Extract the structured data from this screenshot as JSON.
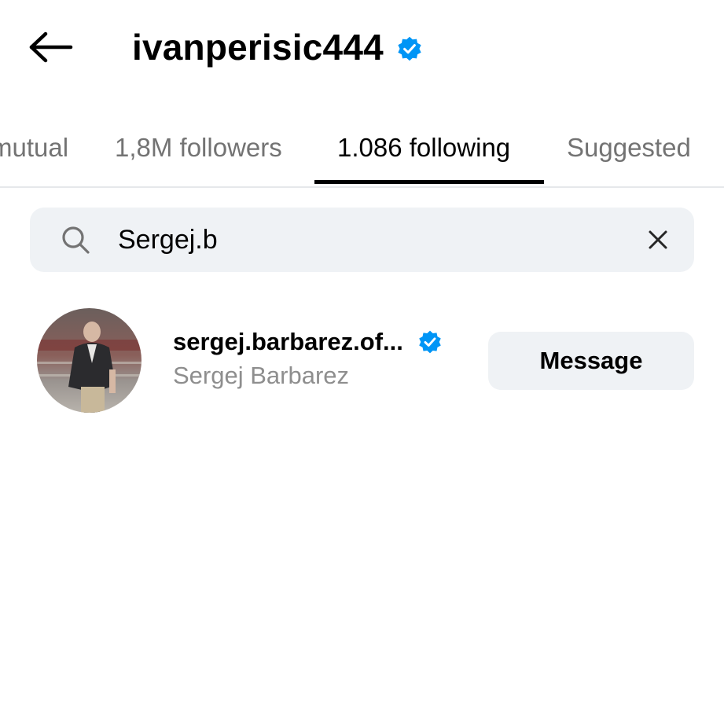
{
  "header": {
    "title": "ivanperisic444",
    "back_icon": "arrow-left-icon",
    "verified_icon": "verified-badge-icon"
  },
  "tabs": [
    {
      "label": "mutual",
      "active": false
    },
    {
      "label": "1,8M followers",
      "active": false
    },
    {
      "label": "1.086 following",
      "active": true
    },
    {
      "label": "Suggested",
      "active": false
    }
  ],
  "search": {
    "value": "Sergej.b",
    "search_icon": "search-icon",
    "clear_icon": "close-icon"
  },
  "results": [
    {
      "username": "sergej.barbarez.of...",
      "full_name": "Sergej Barbarez",
      "verified": true,
      "button_label": "Message"
    }
  ],
  "colors": {
    "verified_blue": "#0095f6",
    "secondary_text": "#737373",
    "field_bg": "#eff2f5"
  }
}
